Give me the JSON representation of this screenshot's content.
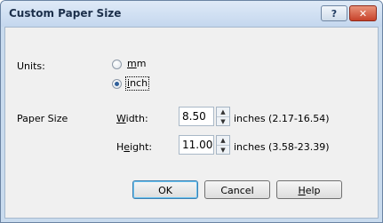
{
  "dialog": {
    "title": "Custom Paper Size",
    "help_button_label": "?",
    "close_button_label": "✕"
  },
  "units": {
    "label": "Units:",
    "options": [
      {
        "pre": "",
        "mnemonic": "m",
        "post": "m",
        "selected": false
      },
      {
        "pre": "",
        "mnemonic": "i",
        "post": "nch",
        "selected": true
      }
    ]
  },
  "paper_size": {
    "label": "Paper Size",
    "width": {
      "pre": "",
      "mnemonic": "W",
      "post": "idth:",
      "value": "8.50",
      "range": "inches (2.17-16.54)"
    },
    "height": {
      "pre": "H",
      "mnemonic": "e",
      "post": "ight:",
      "value": "11.00",
      "range": "inches (3.58-23.39)"
    }
  },
  "buttons": {
    "ok": "OK",
    "cancel": "Cancel",
    "help_pre": "",
    "help_mnemonic": "H",
    "help_post": "elp"
  }
}
